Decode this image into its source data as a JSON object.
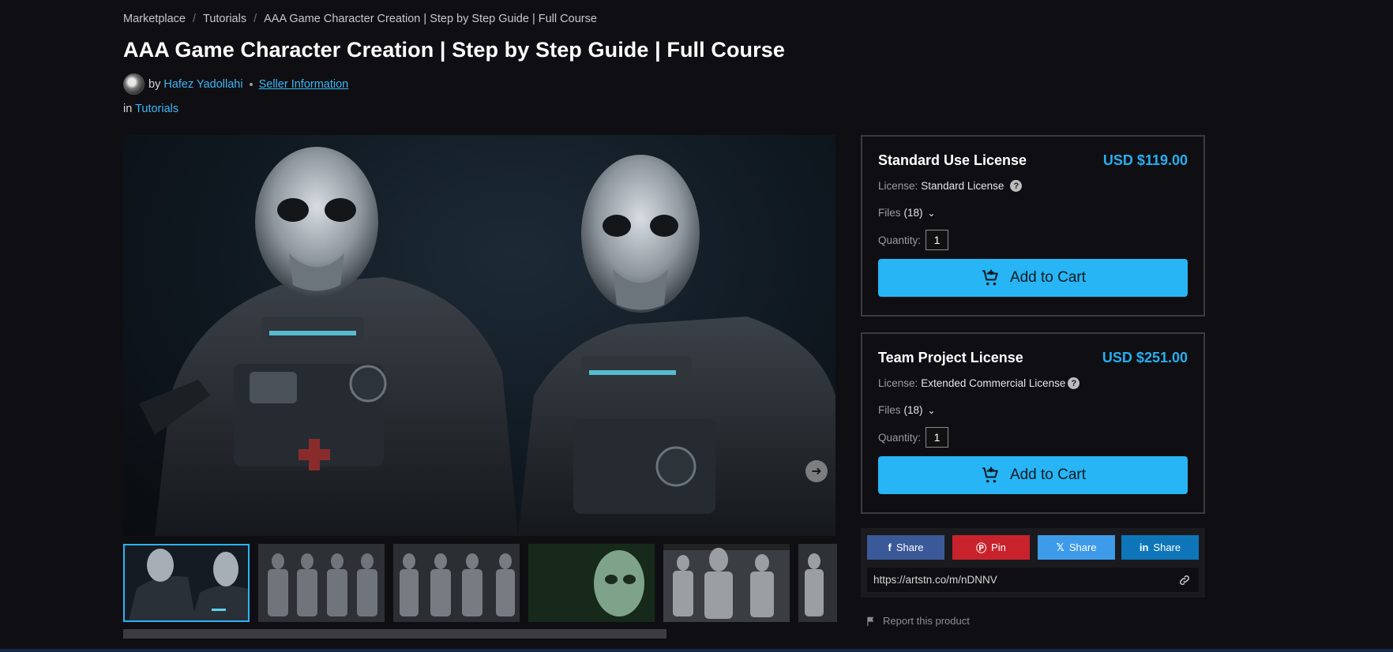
{
  "breadcrumb": [
    {
      "label": "Marketplace"
    },
    {
      "label": "Tutorials"
    },
    {
      "label": "AAA Game Character Creation | Step by Step Guide | Full Course"
    }
  ],
  "title": "AAA Game Character Creation | Step by Step Guide | Full Course",
  "byline": {
    "by": "by",
    "author": "Hafez Yadollahi",
    "seller_info": "Seller Information"
  },
  "category": {
    "prefix": "in",
    "name": "Tutorials"
  },
  "licenses": [
    {
      "name": "Standard Use License",
      "price": "USD $119.00",
      "license_label": "License:",
      "license_value": "Standard License",
      "files_label": "Files",
      "files_count": "(18)",
      "quantity_label": "Quantity:",
      "quantity": "1",
      "cart_label": "Add to Cart"
    },
    {
      "name": "Team Project License",
      "price": "USD $251.00",
      "license_label": "License:",
      "license_value": "Extended Commercial License",
      "files_label": "Files",
      "files_count": "(18)",
      "quantity_label": "Quantity:",
      "quantity": "1",
      "cart_label": "Add to Cart"
    }
  ],
  "share": {
    "facebook": "Share",
    "pinterest": "Pin",
    "x": "Share",
    "linkedin": "Share",
    "url": "https://artstn.co/m/nDNNV"
  },
  "report": "Report this product",
  "colors": {
    "accent": "#27b5f5",
    "facebook": "#3b5998",
    "pinterest": "#c8232c",
    "x": "#3d9be9",
    "linkedin": "#0e76b8"
  }
}
